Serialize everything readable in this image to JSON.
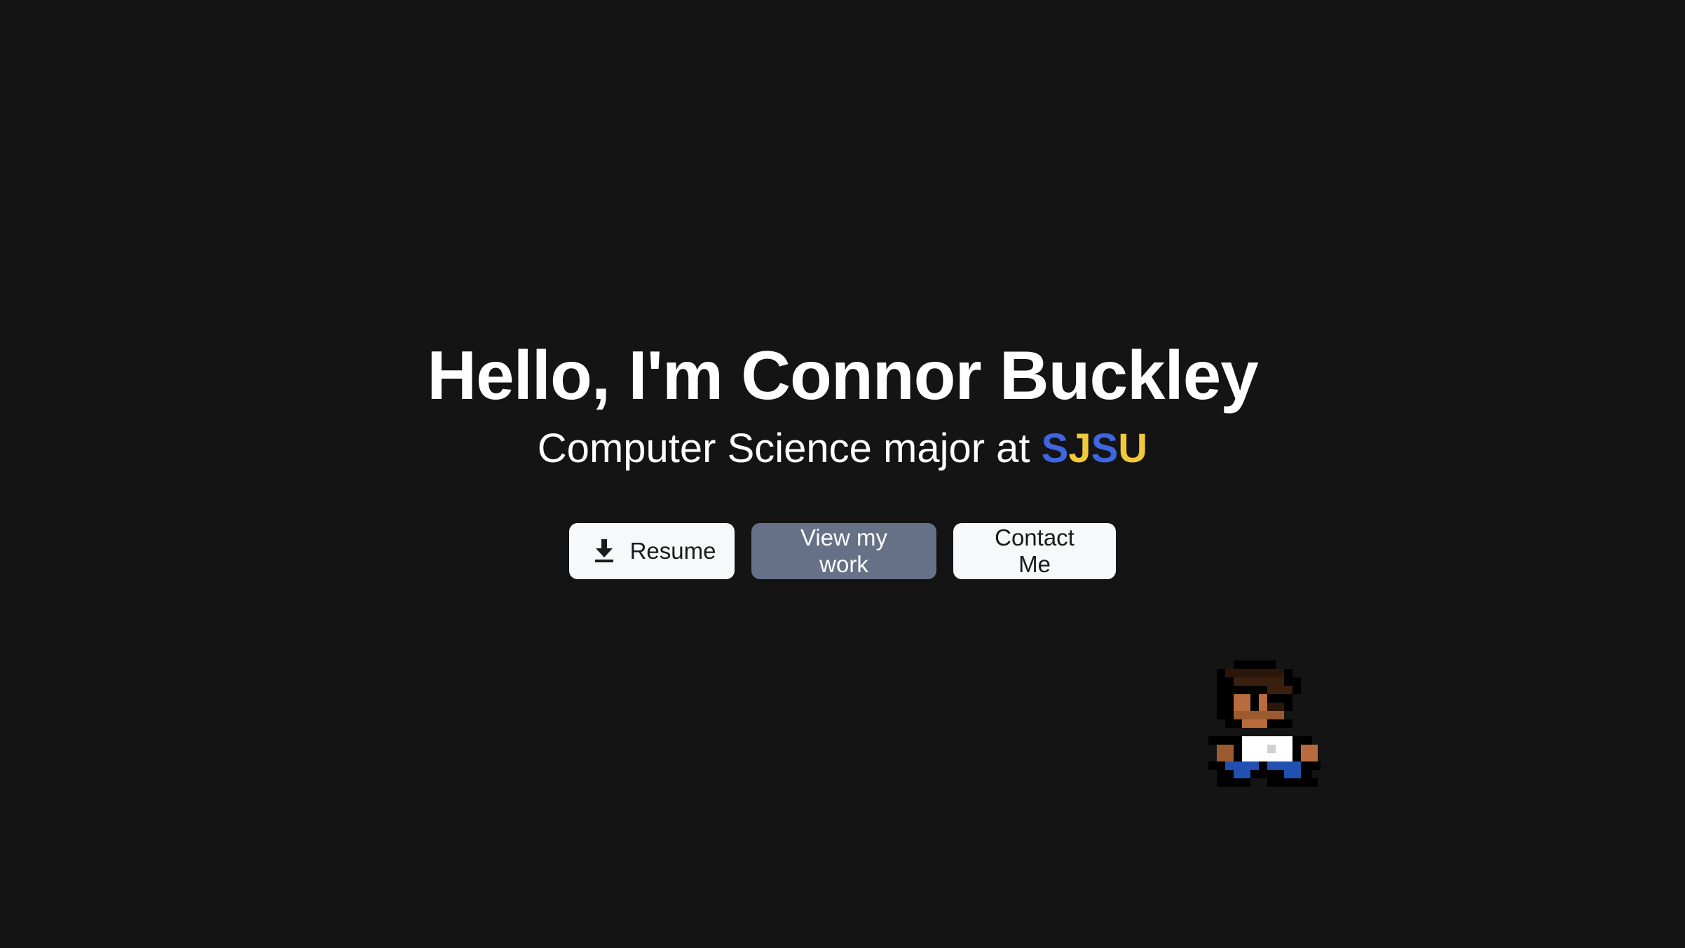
{
  "hero": {
    "title": "Hello, I'm Connor Buckley",
    "subtitle_prefix": "Computer Science major at ",
    "school_letters": [
      "S",
      "J",
      "S",
      "U"
    ]
  },
  "buttons": {
    "resume_label": "Resume",
    "work_label": "View my work",
    "contact_label": "Contact Me"
  },
  "icons": {
    "resume_icon": "download-icon",
    "character": "pixel-character-sprite"
  },
  "colors": {
    "background": "#141414",
    "school_blue": "#3f66e0",
    "school_gold": "#f1c93b",
    "muted_button": "#667086",
    "light_button": "#f7f8fa"
  }
}
